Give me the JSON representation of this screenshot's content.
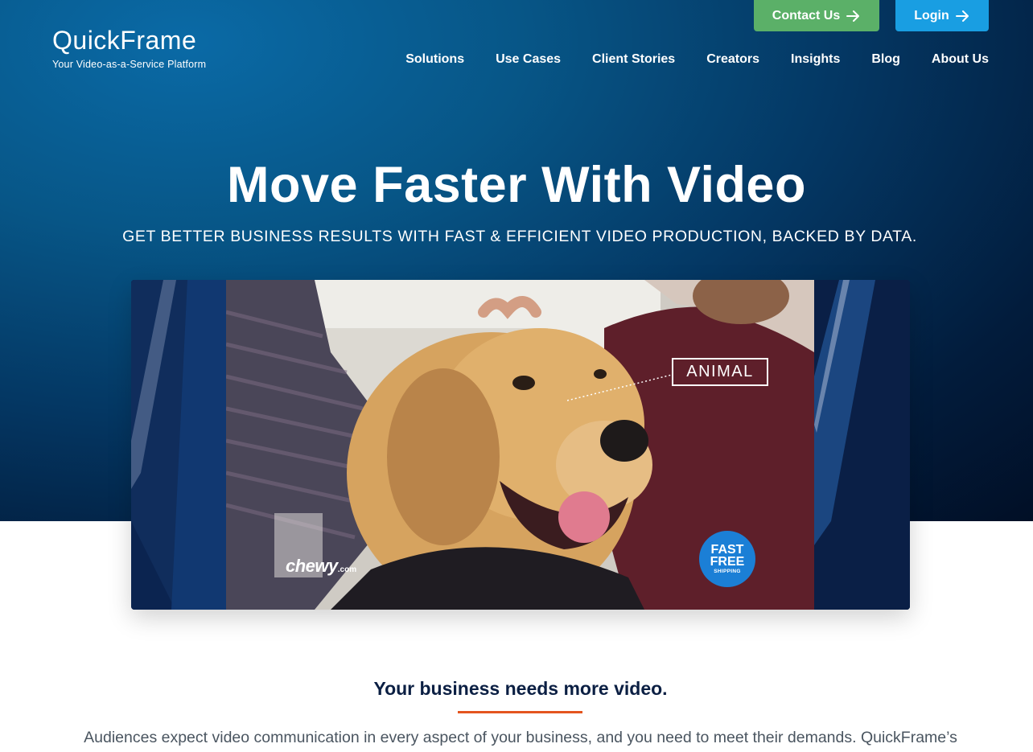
{
  "header": {
    "logo_text": "QuickFrame",
    "tagline": "Your Video-as-a-Service Platform",
    "contact_label": "Contact Us",
    "login_label": "Login",
    "nav": [
      "Solutions",
      "Use Cases",
      "Client Stories",
      "Creators",
      "Insights",
      "Blog",
      "About Us"
    ]
  },
  "hero": {
    "headline": "Move Faster With Video",
    "subheadline": "GET BETTER BUSINESS RESULTS WITH FAST & EFFICIENT VIDEO PRODUCTION, BACKED BY DATA."
  },
  "video": {
    "tag_label": "ANIMAL",
    "brand_mark": "chewy",
    "brand_suffix": ".com",
    "badge_line1": "FAST",
    "badge_line2": "FREE",
    "badge_line3": "SHIPPING"
  },
  "section": {
    "title": "Your business needs more video.",
    "body": "Audiences expect video communication in every aspect of your business, and you need to meet their demands. QuickFrame’s"
  },
  "colors": {
    "contact_button": "#5bb068",
    "login_button": "#199ee2",
    "accent_rule": "#e4551f",
    "heading_navy": "#0b1f43"
  },
  "icons": {
    "contact_arrow": "arrow-right-icon",
    "login_arrow": "arrow-right-icon"
  }
}
